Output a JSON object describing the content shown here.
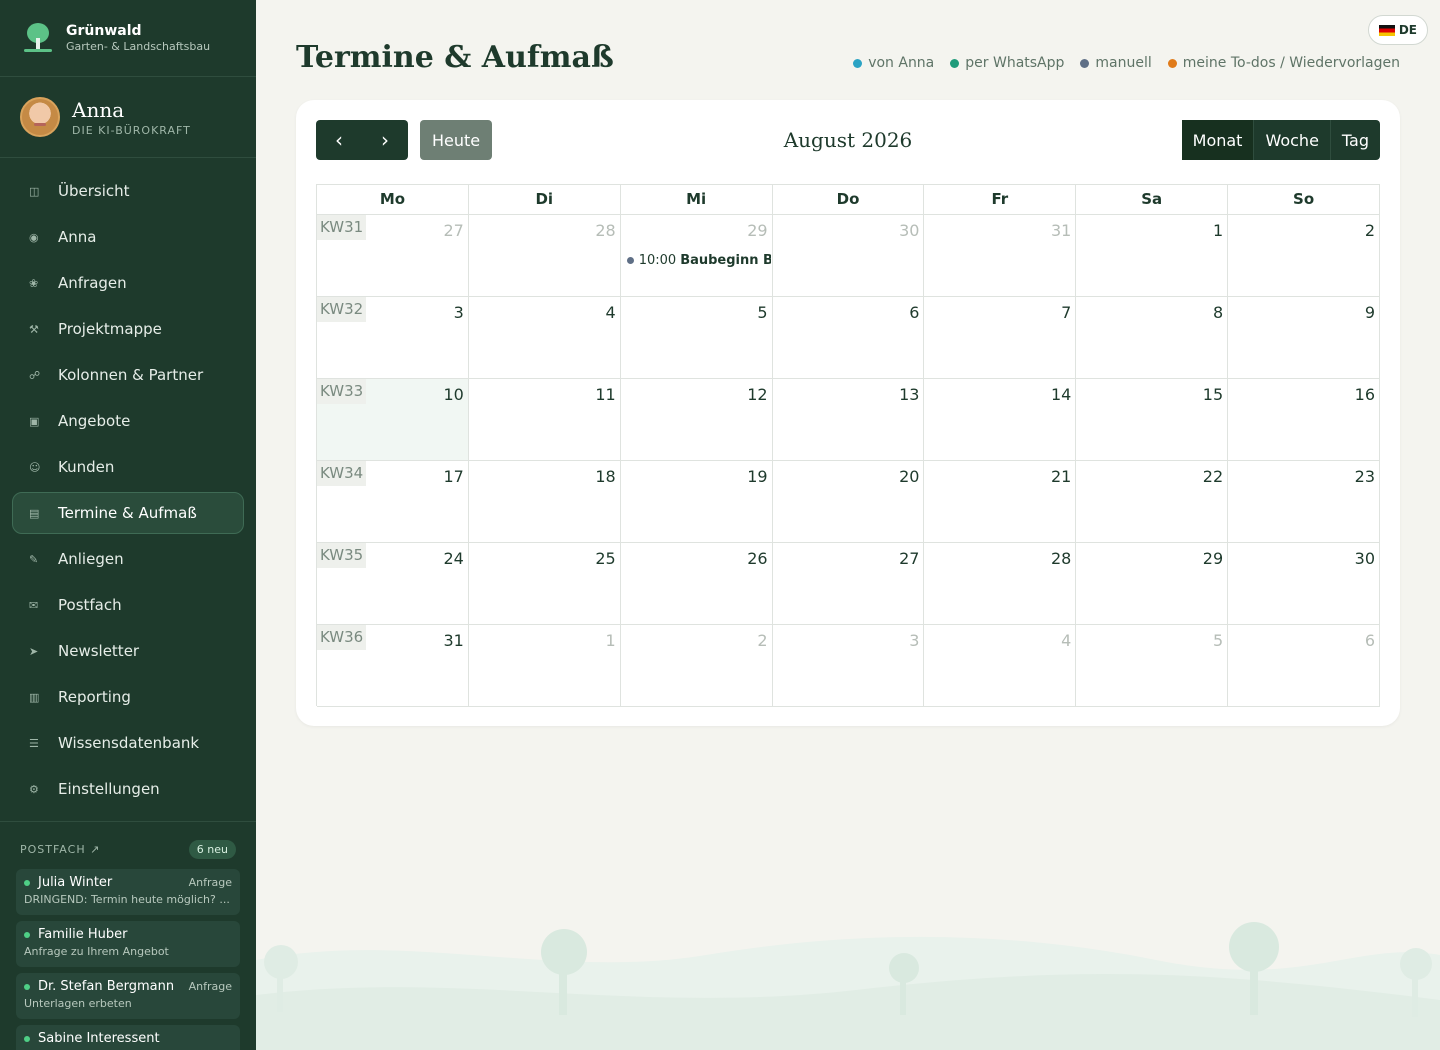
{
  "brand": {
    "name": "Grünwald",
    "subtitle": "Garten- & Landschaftsbau"
  },
  "assistant": {
    "name": "Anna",
    "role": "DIE KI-BÜROKRAFT"
  },
  "nav": [
    {
      "label": "Übersicht",
      "icon": "◫",
      "active": false
    },
    {
      "label": "Anna",
      "icon": "◉",
      "active": false
    },
    {
      "label": "Anfragen",
      "icon": "❀",
      "active": false
    },
    {
      "label": "Projektmappe",
      "icon": "⚒",
      "active": false
    },
    {
      "label": "Kolonnen & Partner",
      "icon": "☍",
      "active": false
    },
    {
      "label": "Angebote",
      "icon": "▣",
      "active": false
    },
    {
      "label": "Kunden",
      "icon": "☺",
      "active": false
    },
    {
      "label": "Termine & Aufmaß",
      "icon": "▤",
      "active": true
    },
    {
      "label": "Anliegen",
      "icon": "✎",
      "active": false
    },
    {
      "label": "Postfach",
      "icon": "✉",
      "active": false
    },
    {
      "label": "Newsletter",
      "icon": "➤",
      "active": false
    },
    {
      "label": "Reporting",
      "icon": "▥",
      "active": false
    },
    {
      "label": "Wissensdatenbank",
      "icon": "☰",
      "active": false
    },
    {
      "label": "Einstellungen",
      "icon": "⚙",
      "active": false
    }
  ],
  "inbox": {
    "title": "POSTFACH ↗",
    "badge": "6 neu",
    "messages": [
      {
        "sender": "Julia Winter",
        "tag": "Anfrage",
        "preview": "DRINGEND: Termin heute möglich? ..."
      },
      {
        "sender": "Familie Huber",
        "tag": "",
        "preview": "Anfrage zu Ihrem Angebot"
      },
      {
        "sender": "Dr. Stefan Bergmann",
        "tag": "Anfrage",
        "preview": "Unterlagen erbeten"
      },
      {
        "sender": "Sabine Interessent",
        "tag": "",
        "preview": ""
      }
    ]
  },
  "header": {
    "title": "Termine & Aufmaß",
    "language": "DE",
    "legend": [
      {
        "label": "von Anna",
        "color": "#2ba3c4"
      },
      {
        "label": "per WhatsApp",
        "color": "#1f9b7a"
      },
      {
        "label": "manuell",
        "color": "#5f6f86"
      },
      {
        "label": "meine To-dos / Wiedervorlagen",
        "color": "#e07b1a"
      }
    ]
  },
  "calendar": {
    "prev_icon": "‹",
    "next_icon": "›",
    "today_label": "Heute",
    "month_title": "August 2026",
    "views": [
      {
        "label": "Monat",
        "selected": true
      },
      {
        "label": "Woche",
        "selected": false
      },
      {
        "label": "Tag",
        "selected": false
      }
    ],
    "weekdays": [
      "Mo",
      "Di",
      "Mi",
      "Do",
      "Fr",
      "Sa",
      "So"
    ],
    "weeks": [
      {
        "kw": "KW31",
        "days": [
          {
            "n": "27",
            "other": true
          },
          {
            "n": "28",
            "other": true
          },
          {
            "n": "29",
            "other": true,
            "event": {
              "time": "10:00",
              "title": "Baubeginn B",
              "color": "#5f6f86"
            }
          },
          {
            "n": "30",
            "other": true
          },
          {
            "n": "31",
            "other": true
          },
          {
            "n": "1"
          },
          {
            "n": "2"
          }
        ]
      },
      {
        "kw": "KW32",
        "days": [
          {
            "n": "3"
          },
          {
            "n": "4"
          },
          {
            "n": "5"
          },
          {
            "n": "6"
          },
          {
            "n": "7"
          },
          {
            "n": "8"
          },
          {
            "n": "9"
          }
        ]
      },
      {
        "kw": "KW33",
        "days": [
          {
            "n": "10",
            "today": true
          },
          {
            "n": "11"
          },
          {
            "n": "12"
          },
          {
            "n": "13"
          },
          {
            "n": "14"
          },
          {
            "n": "15"
          },
          {
            "n": "16"
          }
        ]
      },
      {
        "kw": "KW34",
        "days": [
          {
            "n": "17"
          },
          {
            "n": "18"
          },
          {
            "n": "19"
          },
          {
            "n": "20"
          },
          {
            "n": "21"
          },
          {
            "n": "22"
          },
          {
            "n": "23"
          }
        ]
      },
      {
        "kw": "KW35",
        "days": [
          {
            "n": "24"
          },
          {
            "n": "25"
          },
          {
            "n": "26"
          },
          {
            "n": "27"
          },
          {
            "n": "28"
          },
          {
            "n": "29"
          },
          {
            "n": "30"
          }
        ]
      },
      {
        "kw": "KW36",
        "days": [
          {
            "n": "31"
          },
          {
            "n": "1",
            "other": true
          },
          {
            "n": "2",
            "other": true
          },
          {
            "n": "3",
            "other": true
          },
          {
            "n": "4",
            "other": true
          },
          {
            "n": "5",
            "other": true
          },
          {
            "n": "6",
            "other": true
          }
        ]
      }
    ]
  }
}
